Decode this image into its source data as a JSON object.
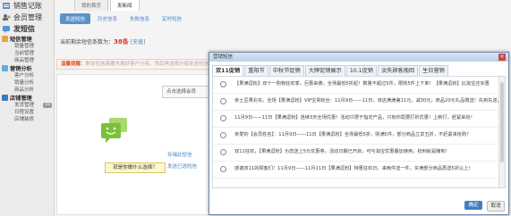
{
  "sidebar": {
    "sections": [
      {
        "label": "销售记账"
      },
      {
        "label": "会员管理"
      },
      {
        "label": "发短信"
      }
    ],
    "groups": [
      {
        "label": "短信管理",
        "items": [
          "销量管理",
          "当前管理",
          "商品管理"
        ]
      },
      {
        "label": "营销分析",
        "items": [
          "客户分析",
          "销量分析",
          "商品分析"
        ]
      },
      {
        "label": "店铺管理",
        "items": [
          {
            "label": "发货管理",
            "badge": "16"
          },
          {
            "label": "日程设置"
          },
          {
            "label": "店铺装修"
          }
        ]
      }
    ]
  },
  "topnav": {
    "tabs": [
      "我的首页",
      "发新闻"
    ]
  },
  "subtabs": [
    "发送短信",
    "历史信息",
    "失败信息",
    "定时短信"
  ],
  "balance": {
    "label": "当前剩余短信条数为：",
    "value": "38条",
    "link": "[充值]"
  },
  "warning": {
    "prefix": "温馨提醒：",
    "text": "群发短信需要先做好客户分组，然后再选择分组发送短信，以免发送失败"
  },
  "select_placeholder": "点击选择会员",
  "help_button": "就是你做什么选择？",
  "links": {
    "save": "存储此短信",
    "send": "发送已选短信"
  },
  "dialog": {
    "title": "营销短信",
    "close": "×",
    "tabs": [
      "双11促销",
      "重阳节",
      "中秋节促销",
      "大牌促销展示",
      "10.1促销",
      "淡失顾客挽回",
      "生日营销"
    ],
    "active_tab": 0,
    "options": [
      "【果满逗粉】双十一购物狂欢季，巨惠来袭，全场最低5折起！数量不超过5件，限购5件上下单！【果满逗粉】比淘宝还实惠",
      "亲土豆果兆实，全场【果满逗粉】VIP宝贵粉丝：11月9日——11日，该店满满第11元，减30元，商品20元礼品赠送！先到先送，淘宝也不过如此了!",
      "11月9日——11日【果满逗粉】连续3天全场优惠！活动只限于指定产品，只有你需要打折优惠！上新打，赶紧来抢！",
      "亲爱的【会员姓名】：11月9日——11日【果满逗粉】全场最低5折，购满5件，部分商品立享五折，不赶紧来抢购？",
      "双11狂欢，【果满逗粉】为您送上5元优惠券，活动日期已开启，可与淘宝优惠叠加使用，抢到就是赚到！",
      "感谢双11的顾客们！11月9日——11月11日【果满逗粉】特惠狂欢日，来两件送一件，买满部分商品再送5折以上!"
    ],
    "ok": "确定",
    "cancel": "取消"
  },
  "colors": {
    "accent": "#5c92c9",
    "warn": "#e0542c",
    "chat_green": "#8cc63f"
  }
}
